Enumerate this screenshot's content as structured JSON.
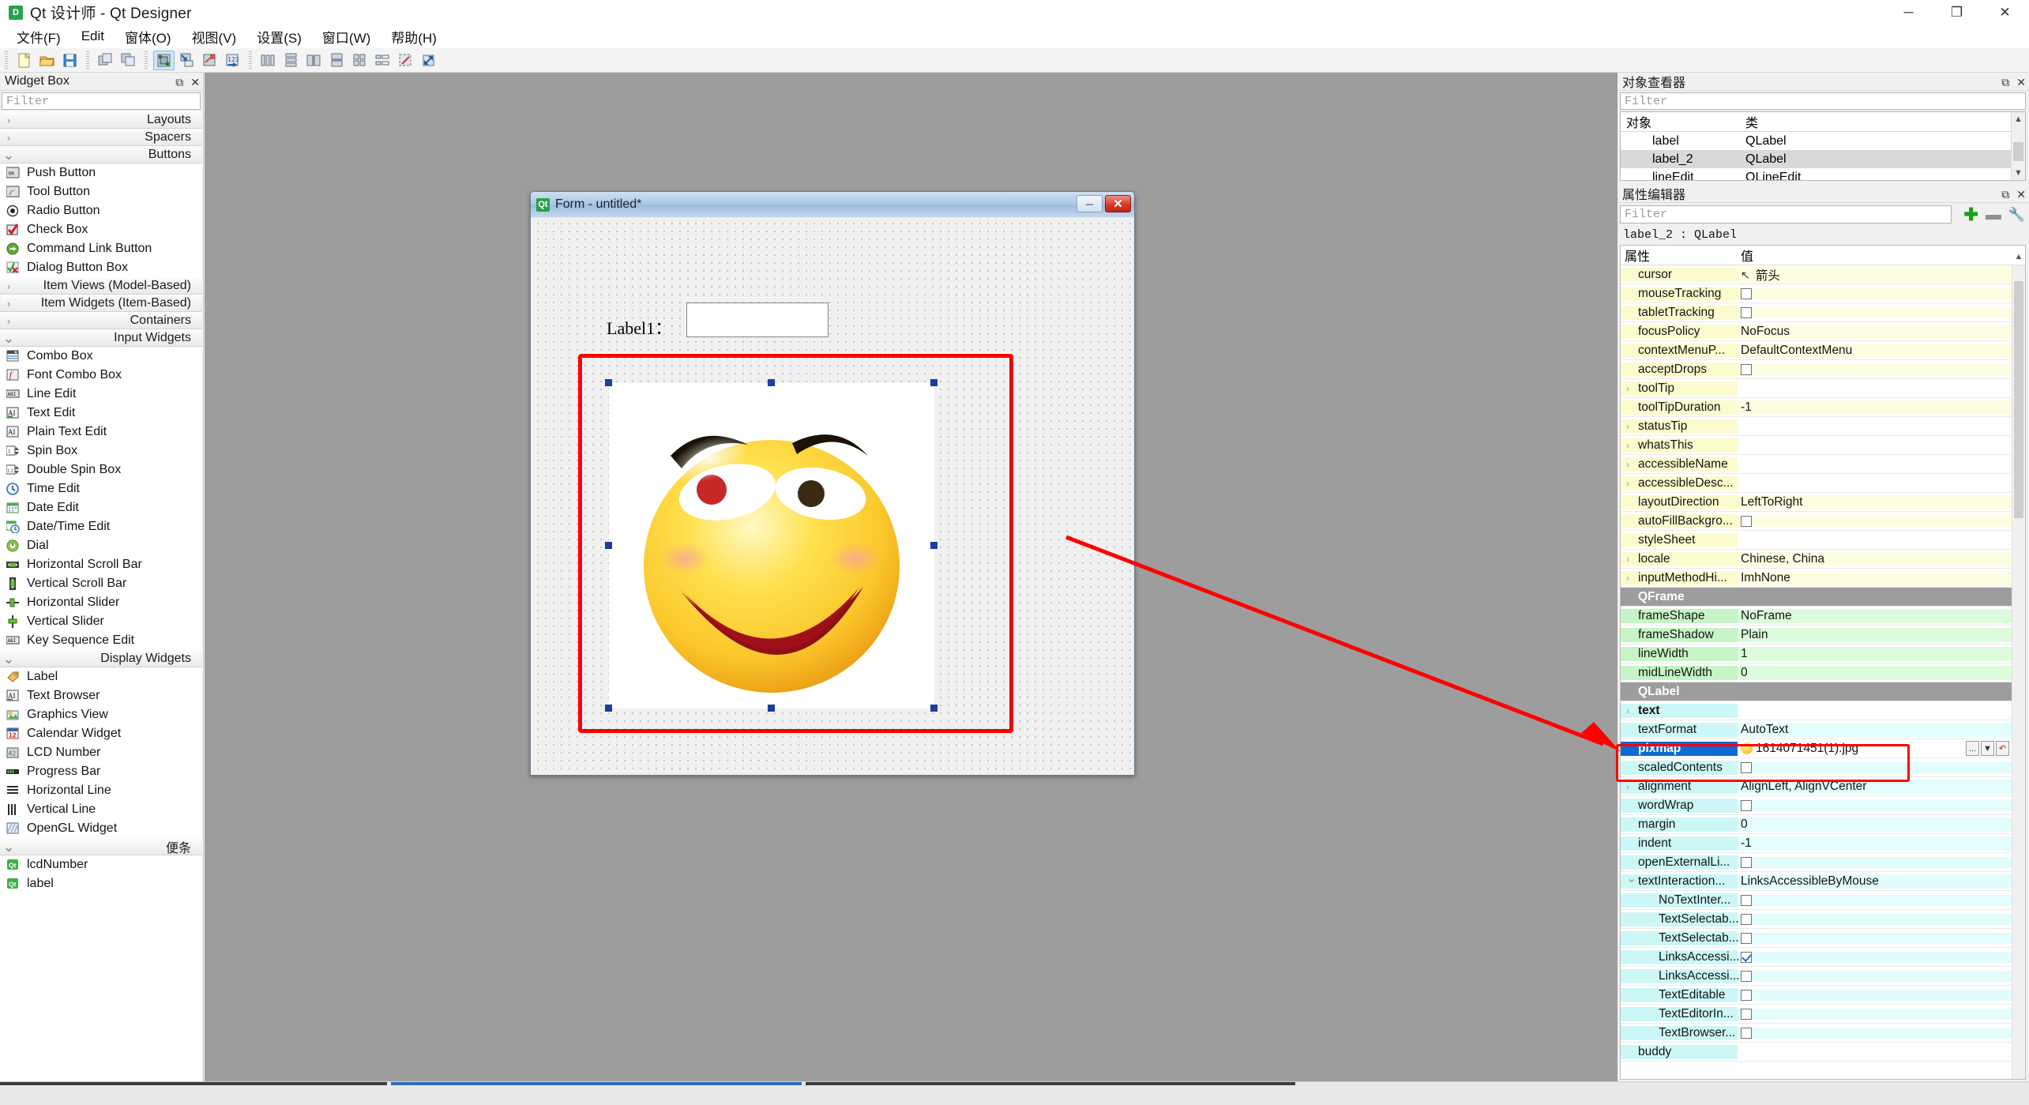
{
  "window": {
    "title": "Qt 设计师 - Qt Designer",
    "app_icon": "qt-designer-icon",
    "minimize": "─",
    "maximize": "❐",
    "close": "✕"
  },
  "menubar": {
    "items": [
      {
        "label": "文件(F)",
        "name": "menu-file"
      },
      {
        "label": "Edit",
        "name": "menu-edit"
      },
      {
        "label": "窗体(O)",
        "name": "menu-form"
      },
      {
        "label": "视图(V)",
        "name": "menu-view"
      },
      {
        "label": "设置(S)",
        "name": "menu-settings"
      },
      {
        "label": "窗口(W)",
        "name": "menu-window"
      },
      {
        "label": "帮助(H)",
        "name": "menu-help"
      }
    ]
  },
  "toolbar": {
    "groups": [
      [
        "new-file-icon",
        "open-folder-icon",
        "save-icon"
      ],
      [
        "copy-window-icon",
        "paste-window-icon"
      ],
      [
        "edit-widgets-icon",
        "edit-signals-icon",
        "edit-buddies-icon",
        "edit-tab-order-icon"
      ],
      [
        "layout-horizontal-icon",
        "layout-vertical-icon",
        "layout-splitter-h-icon",
        "layout-splitter-v-icon",
        "layout-grid-icon",
        "layout-form-icon",
        "break-layout-icon",
        "adjust-size-icon"
      ]
    ],
    "active_tool": "edit-widgets-icon"
  },
  "widget_box": {
    "title": "Widget Box",
    "filter_placeholder": "Filter",
    "restore_icon": "restore-icon",
    "close_icon": "close-icon",
    "groups": [
      {
        "label": "Layouts",
        "expanded": false,
        "items": []
      },
      {
        "label": "Spacers",
        "expanded": false,
        "items": []
      },
      {
        "label": "Buttons",
        "expanded": true,
        "items": [
          {
            "label": "Push Button",
            "icon": "push-button-icon"
          },
          {
            "label": "Tool Button",
            "icon": "tool-button-icon"
          },
          {
            "label": "Radio Button",
            "icon": "radio-button-icon"
          },
          {
            "label": "Check Box",
            "icon": "check-box-icon"
          },
          {
            "label": "Command Link Button",
            "icon": "command-link-icon"
          },
          {
            "label": "Dialog Button Box",
            "icon": "dialog-button-box-icon"
          }
        ]
      },
      {
        "label": "Item Views (Model-Based)",
        "expanded": false,
        "items": []
      },
      {
        "label": "Item Widgets (Item-Based)",
        "expanded": false,
        "items": []
      },
      {
        "label": "Containers",
        "expanded": false,
        "items": []
      },
      {
        "label": "Input Widgets",
        "expanded": true,
        "items": [
          {
            "label": "Combo Box",
            "icon": "combo-box-icon"
          },
          {
            "label": "Font Combo Box",
            "icon": "font-combo-box-icon"
          },
          {
            "label": "Line Edit",
            "icon": "line-edit-icon"
          },
          {
            "label": "Text Edit",
            "icon": "text-edit-icon"
          },
          {
            "label": "Plain Text Edit",
            "icon": "plain-text-edit-icon"
          },
          {
            "label": "Spin Box",
            "icon": "spin-box-icon"
          },
          {
            "label": "Double Spin Box",
            "icon": "double-spin-box-icon"
          },
          {
            "label": "Time Edit",
            "icon": "time-edit-icon"
          },
          {
            "label": "Date Edit",
            "icon": "date-edit-icon"
          },
          {
            "label": "Date/Time Edit",
            "icon": "date-time-edit-icon"
          },
          {
            "label": "Dial",
            "icon": "dial-icon"
          },
          {
            "label": "Horizontal Scroll Bar",
            "icon": "horizontal-scroll-bar-icon"
          },
          {
            "label": "Vertical Scroll Bar",
            "icon": "vertical-scroll-bar-icon"
          },
          {
            "label": "Horizontal Slider",
            "icon": "horizontal-slider-icon"
          },
          {
            "label": "Vertical Slider",
            "icon": "vertical-slider-icon"
          },
          {
            "label": "Key Sequence Edit",
            "icon": "key-sequence-edit-icon"
          }
        ]
      },
      {
        "label": "Display Widgets",
        "expanded": true,
        "items": [
          {
            "label": "Label",
            "icon": "label-icon"
          },
          {
            "label": "Text Browser",
            "icon": "text-browser-icon"
          },
          {
            "label": "Graphics View",
            "icon": "graphics-view-icon"
          },
          {
            "label": "Calendar Widget",
            "icon": "calendar-widget-icon"
          },
          {
            "label": "LCD Number",
            "icon": "lcd-number-icon"
          },
          {
            "label": "Progress Bar",
            "icon": "progress-bar-icon"
          },
          {
            "label": "Horizontal Line",
            "icon": "horizontal-line-icon"
          },
          {
            "label": "Vertical Line",
            "icon": "vertical-line-icon"
          },
          {
            "label": "OpenGL Widget",
            "icon": "opengl-widget-icon"
          }
        ]
      },
      {
        "label": "便条",
        "expanded": true,
        "items": [
          {
            "label": "lcdNumber",
            "icon": "qt-scratch-icon"
          },
          {
            "label": "label",
            "icon": "qt-scratch-icon"
          }
        ]
      }
    ]
  },
  "form": {
    "title": "Form - untitled*",
    "icon": "qt-icon",
    "minimize": "─",
    "close": "✕",
    "label_text": "Label1：",
    "line_edit_value": "",
    "image_name": "smiley-face-image"
  },
  "object_inspector": {
    "title": "对象查看器",
    "filter_placeholder": "Filter",
    "restore_icon": "restore-icon",
    "close_icon": "close-icon",
    "headers": [
      "对象",
      "类"
    ],
    "rows": [
      {
        "object": "label",
        "class": "QLabel",
        "selected": false
      },
      {
        "object": "label_2",
        "class": "QLabel",
        "selected": true
      },
      {
        "object": "lineEdit",
        "class": "QLineEdit",
        "selected": false
      }
    ]
  },
  "property_editor": {
    "title": "属性编辑器",
    "filter_placeholder": "Filter",
    "restore_icon": "restore-icon",
    "close_icon": "close-icon",
    "add_icon": "plus-icon",
    "remove_icon": "minus-icon",
    "config_icon": "wrench-icon",
    "object_line": "label_2 : QLabel",
    "headers": [
      "属性",
      "值"
    ],
    "rows": [
      {
        "name": "cursor",
        "value": "箭头",
        "type": "cursor",
        "tint": "y"
      },
      {
        "name": "mouseTracking",
        "value": "",
        "type": "checkbox",
        "checked": false,
        "tint": "y"
      },
      {
        "name": "tabletTracking",
        "value": "",
        "type": "checkbox",
        "checked": false,
        "tint": "y"
      },
      {
        "name": "focusPolicy",
        "value": "NoFocus",
        "type": "text",
        "tint": "y"
      },
      {
        "name": "contextMenuP...",
        "value": "DefaultContextMenu",
        "type": "text",
        "tint": "y"
      },
      {
        "name": "acceptDrops",
        "value": "",
        "type": "checkbox",
        "checked": false,
        "tint": "y"
      },
      {
        "name": "toolTip",
        "value": "",
        "type": "text",
        "expandable": true,
        "tint": "y"
      },
      {
        "name": "toolTipDuration",
        "value": "-1",
        "type": "text",
        "tint": "y"
      },
      {
        "name": "statusTip",
        "value": "",
        "type": "text",
        "expandable": true,
        "tint": "y"
      },
      {
        "name": "whatsThis",
        "value": "",
        "type": "text",
        "expandable": true,
        "tint": "y"
      },
      {
        "name": "accessibleName",
        "value": "",
        "type": "text",
        "expandable": true,
        "tint": "y"
      },
      {
        "name": "accessibleDesc...",
        "value": "",
        "type": "text",
        "expandable": true,
        "tint": "y"
      },
      {
        "name": "layoutDirection",
        "value": "LeftToRight",
        "type": "text",
        "tint": "y"
      },
      {
        "name": "autoFillBackgro...",
        "value": "",
        "type": "checkbox",
        "checked": false,
        "tint": "y"
      },
      {
        "name": "styleSheet",
        "value": "",
        "type": "text",
        "tint": "y"
      },
      {
        "name": "locale",
        "value": "Chinese, China",
        "type": "text",
        "expandable": true,
        "tint": "y"
      },
      {
        "name": "inputMethodHi...",
        "value": "ImhNone",
        "type": "text",
        "expandable": true,
        "tint": "y"
      },
      {
        "name": "QFrame",
        "value": "",
        "type": "group"
      },
      {
        "name": "frameShape",
        "value": "NoFrame",
        "type": "text",
        "tint": "g"
      },
      {
        "name": "frameShadow",
        "value": "Plain",
        "type": "text",
        "tint": "g"
      },
      {
        "name": "lineWidth",
        "value": "1",
        "type": "text",
        "tint": "g"
      },
      {
        "name": "midLineWidth",
        "value": "0",
        "type": "text",
        "tint": "g"
      },
      {
        "name": "QLabel",
        "value": "",
        "type": "group"
      },
      {
        "name": "text",
        "value": "",
        "type": "text",
        "expandable": true,
        "bold": true,
        "tint": "c"
      },
      {
        "name": "textFormat",
        "value": "AutoText",
        "type": "text",
        "tint": "c"
      },
      {
        "name": "pixmap",
        "value": "1614071451(1).jpg",
        "type": "pixmap",
        "selected": true,
        "tint": "c",
        "value_icon": "smiley-thumb-icon",
        "browse_label": "...",
        "dropdown_label": "▼",
        "reset_label": "↶"
      },
      {
        "name": "scaledContents",
        "value": "",
        "type": "checkbox",
        "checked": false,
        "tint": "c"
      },
      {
        "name": "alignment",
        "value": "AlignLeft, AlignVCenter",
        "type": "text",
        "expandable": true,
        "tint": "c"
      },
      {
        "name": "wordWrap",
        "value": "",
        "type": "checkbox",
        "checked": false,
        "tint": "c"
      },
      {
        "name": "margin",
        "value": "0",
        "type": "text",
        "tint": "c"
      },
      {
        "name": "indent",
        "value": "-1",
        "type": "text",
        "tint": "c"
      },
      {
        "name": "openExternalLi...",
        "value": "",
        "type": "checkbox",
        "checked": false,
        "tint": "c"
      },
      {
        "name": "textInteraction...",
        "value": "LinksAccessibleByMouse",
        "type": "text",
        "expandable": true,
        "expanded": true,
        "tint": "c"
      },
      {
        "name": "NoTextInter...",
        "value": "",
        "type": "checkbox",
        "checked": false,
        "indent": 2,
        "tint": "c"
      },
      {
        "name": "TextSelectab...",
        "value": "",
        "type": "checkbox",
        "checked": false,
        "indent": 2,
        "tint": "c"
      },
      {
        "name": "TextSelectab...",
        "value": "",
        "type": "checkbox",
        "checked": false,
        "indent": 2,
        "tint": "c"
      },
      {
        "name": "LinksAccessi...",
        "value": "",
        "type": "checkbox",
        "checked": true,
        "indent": 2,
        "tint": "c"
      },
      {
        "name": "LinksAccessi...",
        "value": "",
        "type": "checkbox",
        "checked": false,
        "indent": 2,
        "tint": "c"
      },
      {
        "name": "TextEditable",
        "value": "",
        "type": "checkbox",
        "checked": false,
        "indent": 2,
        "tint": "c"
      },
      {
        "name": "TextEditorIn...",
        "value": "",
        "type": "checkbox",
        "checked": false,
        "indent": 2,
        "tint": "c"
      },
      {
        "name": "TextBrowser...",
        "value": "",
        "type": "checkbox",
        "checked": false,
        "indent": 2,
        "tint": "c"
      },
      {
        "name": "buddy",
        "value": "",
        "type": "text",
        "tint": "c"
      }
    ]
  },
  "annotation": {
    "arrow_color": "#ff0000",
    "highlight_color": "#ff0000"
  }
}
